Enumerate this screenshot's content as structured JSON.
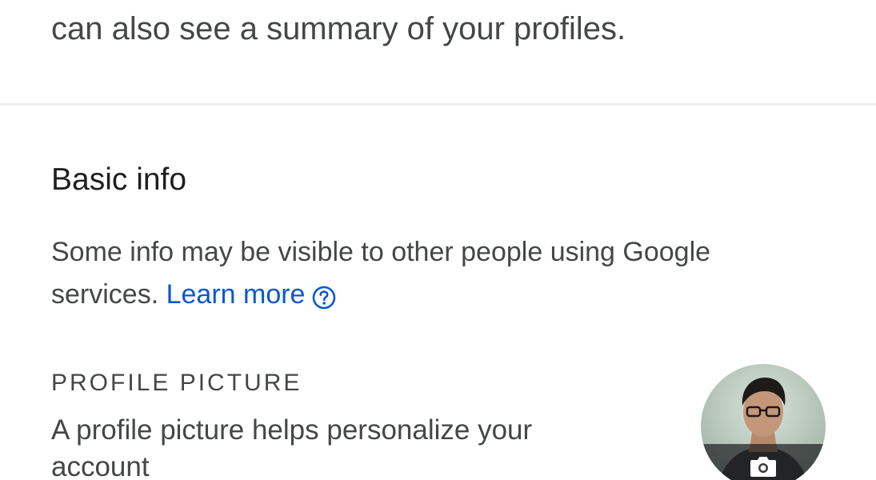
{
  "intro": {
    "text": "can also see a summary of your profiles."
  },
  "basic_info": {
    "title": "Basic info",
    "description_line1": "Some info may be visible to other people using Google",
    "description_line2": "services.",
    "learn_more": "Learn more",
    "help_icon": "help-circle-icon"
  },
  "profile_picture": {
    "label": "PROFILE PICTURE",
    "description_line1": "A profile picture helps personalize your",
    "description_line2": "account",
    "camera_icon": "camera-icon"
  },
  "colors": {
    "link": "#0b57d0",
    "text": "#444746",
    "heading": "#1f1f1f"
  }
}
